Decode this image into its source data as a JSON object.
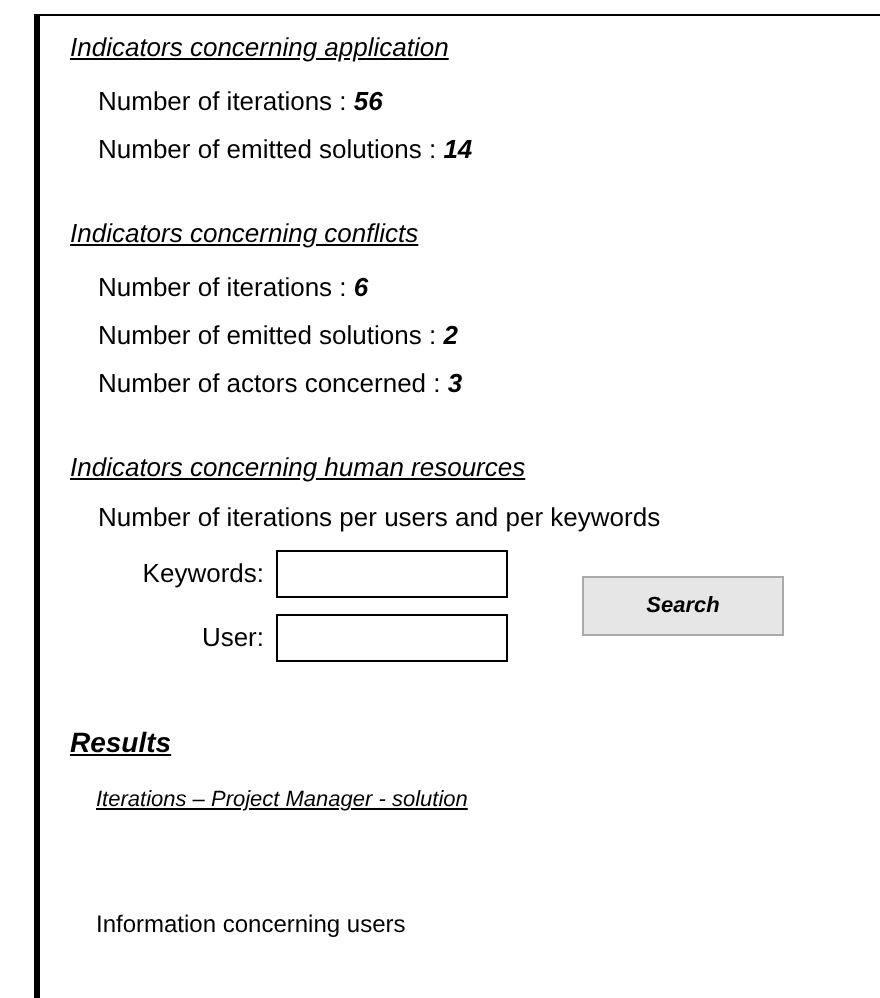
{
  "sections": [
    {
      "heading": "Indicators concerning application",
      "stats": [
        {
          "label": "Number of iterations :",
          "value": "56"
        },
        {
          "label": "Number of emitted solutions :",
          "value": "14"
        }
      ]
    },
    {
      "heading": "Indicators concerning conflicts",
      "stats": [
        {
          "label": "Number of iterations :",
          "value": "6"
        },
        {
          "label": "Number of emitted solutions :",
          "value": "2"
        },
        {
          "label": "Number of actors concerned :",
          "value": "3"
        }
      ]
    }
  ],
  "human_resources": {
    "heading": "Indicators concerning human resources",
    "description": "Number of iterations per users and per keywords",
    "fields": [
      {
        "label": "Keywords:"
      },
      {
        "label": "User:"
      }
    ],
    "button": "Search"
  },
  "results": {
    "heading": "Results",
    "link": "Iterations – Project Manager - solution",
    "note": "Information concerning users"
  }
}
